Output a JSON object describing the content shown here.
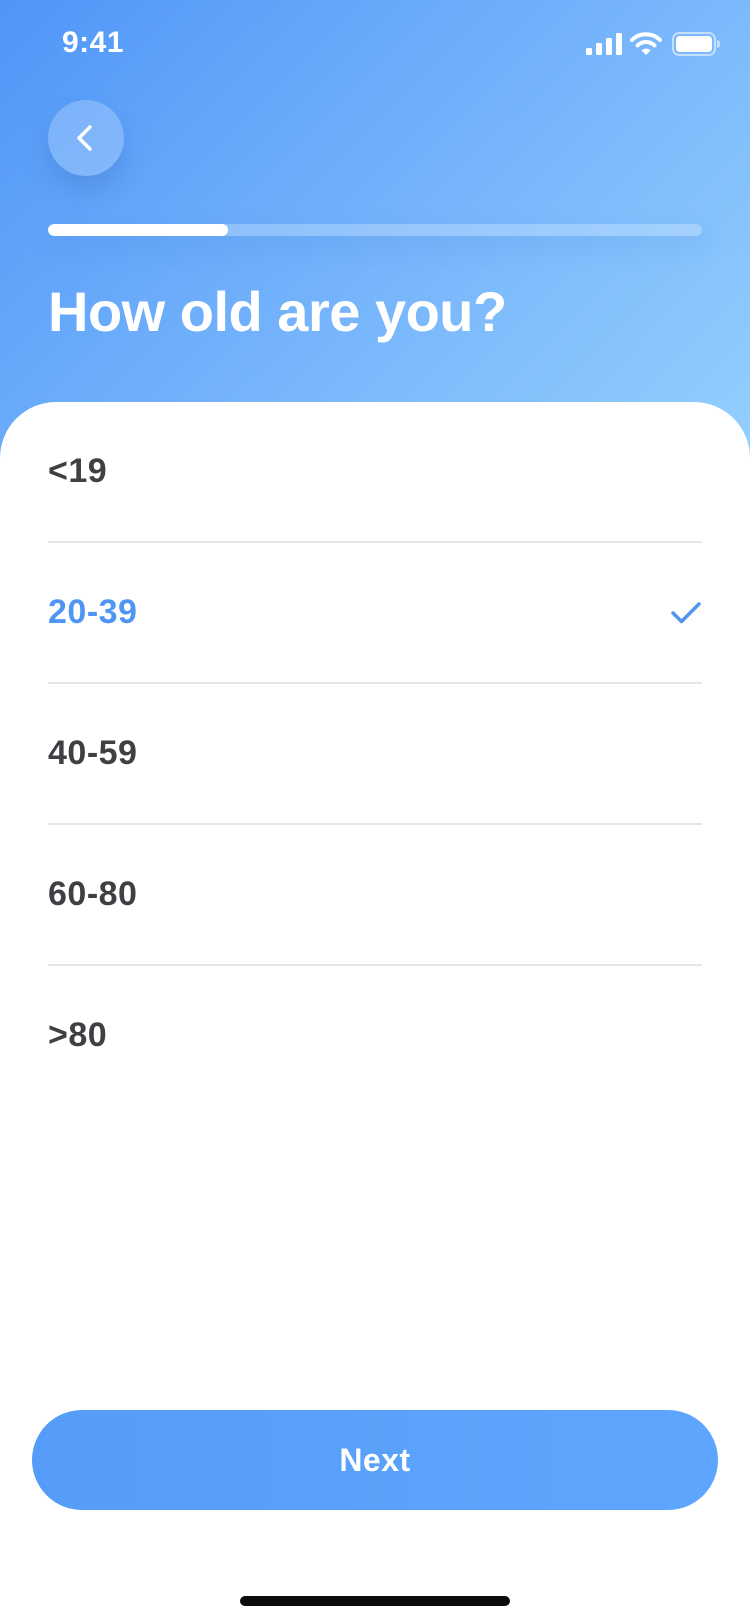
{
  "status_bar": {
    "time": "9:41"
  },
  "header": {
    "back_icon": "chevron-left-icon",
    "progress": 0.275,
    "title": "How old are you?"
  },
  "options": [
    {
      "label": "<19",
      "selected": false
    },
    {
      "label": "20-39",
      "selected": true
    },
    {
      "label": "40-59",
      "selected": false
    },
    {
      "label": "60-80",
      "selected": false
    },
    {
      "label": ">80",
      "selected": false
    }
  ],
  "selected_icon": "checkmark-icon",
  "footer": {
    "next_label": "Next"
  },
  "colors": {
    "accent": "#4f95f3",
    "header_gradient_start": "#4f96f8",
    "header_gradient_end": "#95d0fe",
    "option_text": "#3f3f44",
    "divider": "#e6e6ea"
  }
}
